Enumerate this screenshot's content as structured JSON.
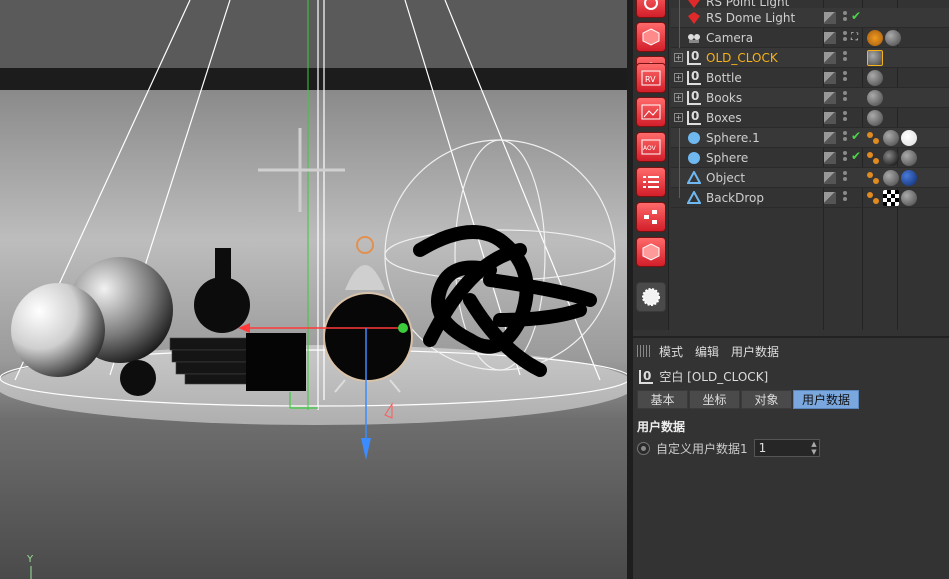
{
  "viewport": {
    "axis_label": "Y"
  },
  "object_manager": {
    "rows": [
      {
        "name": "RS Point Light",
        "icon": "light-icon",
        "highlight": false
      },
      {
        "name": "RS Dome Light",
        "icon": "light-icon",
        "highlight": false
      },
      {
        "name": "Camera",
        "icon": "camera-icon",
        "highlight": false
      },
      {
        "name": "OLD_CLOCK",
        "icon": "null-icon",
        "highlight": true
      },
      {
        "name": "Bottle",
        "icon": "null-icon",
        "highlight": false
      },
      {
        "name": "Books",
        "icon": "null-icon",
        "highlight": false
      },
      {
        "name": "Boxes",
        "icon": "null-icon",
        "highlight": false
      },
      {
        "name": "Sphere.1",
        "icon": "sphere-icon",
        "highlight": false
      },
      {
        "name": "Sphere",
        "icon": "sphere-icon",
        "highlight": false
      },
      {
        "name": "Object",
        "icon": "polygon-icon",
        "highlight": false
      },
      {
        "name": "BackDrop",
        "icon": "polygon-icon",
        "highlight": false
      }
    ]
  },
  "attributes": {
    "menu": [
      "模式",
      "编辑",
      "用户数据"
    ],
    "object_title": "空白 [OLD_CLOCK]",
    "tabs": [
      {
        "label": "基本",
        "active": false
      },
      {
        "label": "坐标",
        "active": false
      },
      {
        "label": "对象",
        "active": false
      },
      {
        "label": "用户数据",
        "active": true
      }
    ],
    "section": "用户数据",
    "field_label": "自定义用户数据1",
    "field_value": "1"
  },
  "colors": {
    "accent_tab": "#7aa7de",
    "highlight_name": "#f6b21a",
    "redshift_red": "#d21e2a"
  }
}
